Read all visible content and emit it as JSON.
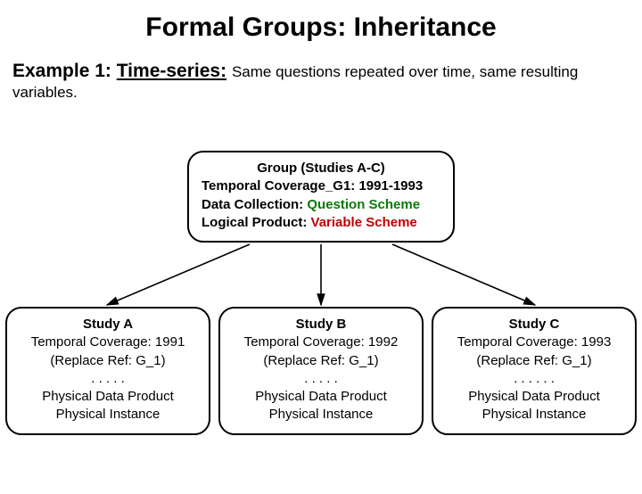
{
  "title": "Formal Groups: Inheritance",
  "example": {
    "lead_prefix": "Example 1: ",
    "lead_underlined": "Time-series:",
    "rest": " Same questions repeated over time, same resulting variables."
  },
  "group": {
    "header": "Group (Studies A-C)",
    "line1_label": "Temporal Coverage_G1:",
    "line1_value": "1991-1993",
    "line2_label": "Data Collection: ",
    "line2_value": "Question Scheme",
    "line3_label": "Logical Product: ",
    "line3_value": "Variable Scheme"
  },
  "studies": [
    {
      "name": "Study A",
      "coverage": "Temporal Coverage: 1991",
      "replace": "(Replace Ref: G_1)",
      "dots": ". . . . .",
      "pdp": "Physical Data Product",
      "pi": "Physical Instance"
    },
    {
      "name": "Study B",
      "coverage": "Temporal Coverage: 1992",
      "replace": "(Replace Ref: G_1)",
      "dots": ". . . . .",
      "pdp": "Physical Data Product",
      "pi": "Physical Instance"
    },
    {
      "name": "Study C",
      "coverage": "Temporal Coverage: 1993",
      "replace": "(Replace Ref: G_1)",
      "dots": ". . . . . .",
      "pdp": "Physical Data Product",
      "pi": "Physical Instance"
    }
  ]
}
